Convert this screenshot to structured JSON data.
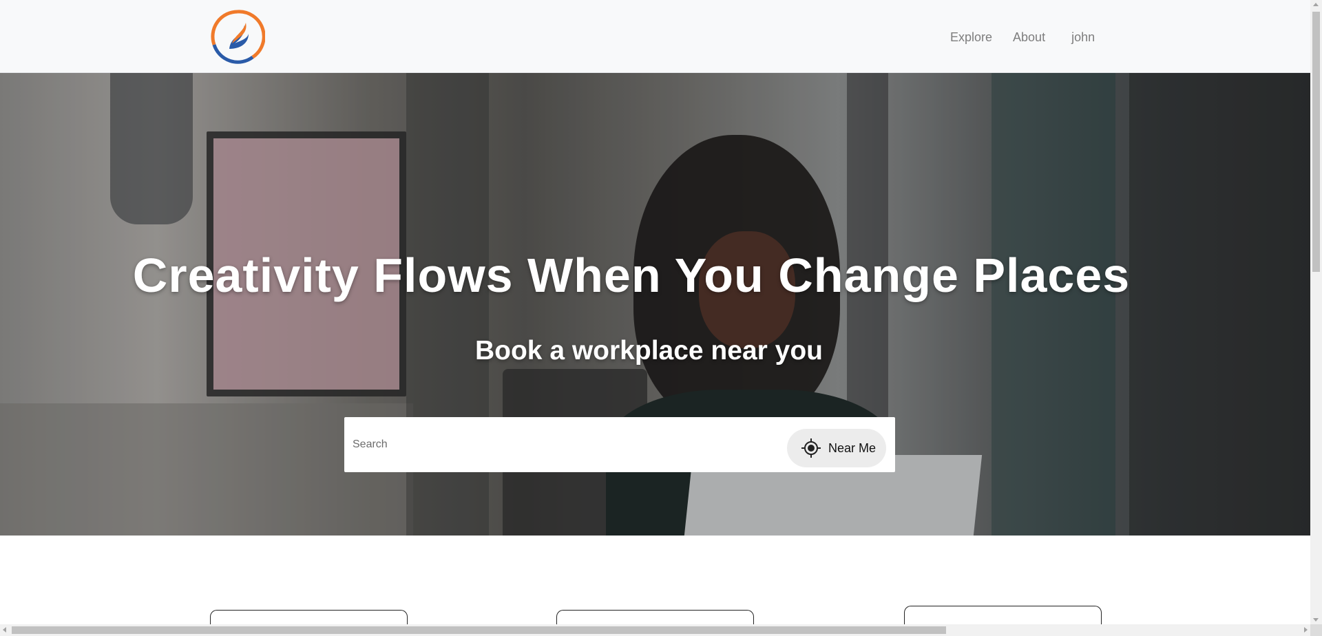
{
  "navbar": {
    "logo_icon": "brand-swirl-logo",
    "links": {
      "explore": "Explore",
      "about": "About",
      "user": "john"
    }
  },
  "hero": {
    "title": "Creativity Flows When You Change Places",
    "subtitle": "Book a workplace near you",
    "search": {
      "placeholder": "Search",
      "value": ""
    },
    "near_me": {
      "label": "Near Me",
      "icon": "crosshair-location-icon"
    }
  },
  "colors": {
    "navbar_bg": "#f8f9fa",
    "nav_link": "#7d7d7d",
    "logo_blue": "#2a5ba8",
    "logo_orange": "#f07a2a",
    "hero_text": "#ffffff",
    "near_me_bg": "#ececec"
  }
}
